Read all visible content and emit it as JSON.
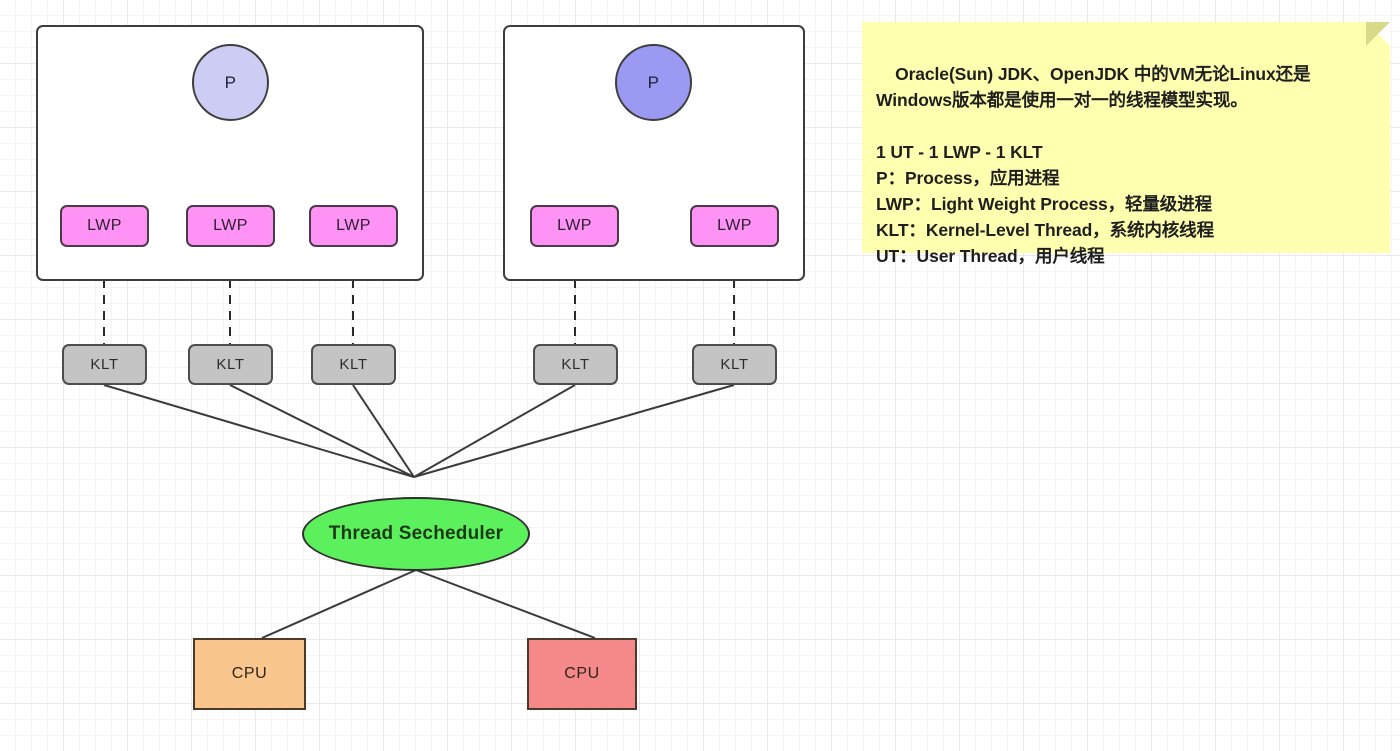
{
  "diagram": {
    "title": "JVM one-to-one thread model",
    "colors": {
      "background": "#ffffff",
      "grid_minor": "#f4f4f4",
      "grid_major": "#e9e9e9",
      "stroke": "#3d3d3d",
      "process_box_fill": "#ffffff",
      "p_circle_left_fill": "#ccccf5",
      "p_circle_right_fill": "#9a9af2",
      "lwp_fill": "#ff93f5",
      "klt_fill": "#c4c4c4",
      "scheduler_fill": "#5cf05c",
      "scheduler_text": "#1c3a18",
      "cpu_left_fill": "#f9c68d",
      "cpu_right_fill": "#f58989",
      "note_fill": "#ffffb0",
      "note_fold": "#d9d98a",
      "note_text": "#1f1f1f"
    },
    "processes": [
      {
        "name": "process-left",
        "circle_label": "P",
        "circle_fill": "#ccccf5",
        "lwps": [
          {
            "label": "LWP"
          },
          {
            "label": "LWP"
          },
          {
            "label": "LWP"
          }
        ]
      },
      {
        "name": "process-right",
        "circle_label": "P",
        "circle_fill": "#9a9af2",
        "lwps": [
          {
            "label": "LWP"
          },
          {
            "label": "LWP"
          }
        ]
      }
    ],
    "kernel_threads": [
      {
        "label": "KLT"
      },
      {
        "label": "KLT"
      },
      {
        "label": "KLT"
      },
      {
        "label": "KLT"
      },
      {
        "label": "KLT"
      }
    ],
    "scheduler": {
      "label": "Thread Secheduler"
    },
    "cpus": [
      {
        "label": "CPU",
        "fill": "#f9c68d"
      },
      {
        "label": "CPU",
        "fill": "#f58989"
      }
    ],
    "note": {
      "paragraph": "Oracle(Sun) JDK、OpenJDK 中的VM无论Linux还是Windows版本都是使用一对一的线程模型实现。",
      "lines": [
        "1 UT - 1 LWP - 1 KLT",
        "P：Process，应用进程",
        "LWP：Light Weight Process，轻量级进程",
        "KLT：Kernel-Level Thread，系统内核线程",
        "UT：User Thread，用户线程"
      ],
      "text": "Oracle(Sun) JDK、OpenJDK 中的VM无论Linux还是Windows版本都是使用一对一的线程模型实现。\n\n1 UT - 1 LWP - 1 KLT\nP：Process，应用进程\nLWP：Light Weight Process，轻量级进程\nKLT：Kernel-Level Thread，系统内核线程\nUT：User Thread，用户线程"
    }
  }
}
